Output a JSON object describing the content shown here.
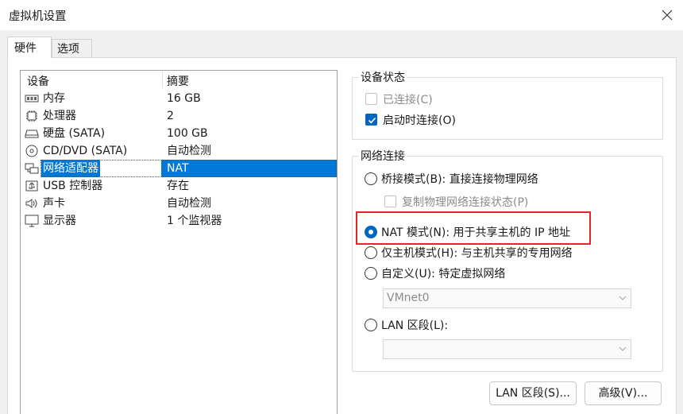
{
  "window": {
    "title": "虚拟机设置"
  },
  "tabs": [
    {
      "label": "硬件"
    },
    {
      "label": "选项"
    }
  ],
  "device_list": {
    "columns": [
      "设备",
      "摘要"
    ],
    "rows": [
      {
        "name": "内存",
        "summary": "16 GB",
        "icon": "memory-icon"
      },
      {
        "name": "处理器",
        "summary": "2",
        "icon": "processor-icon"
      },
      {
        "name": "硬盘 (SATA)",
        "summary": "100 GB",
        "icon": "hard-disk-icon"
      },
      {
        "name": "CD/DVD (SATA)",
        "summary": "自动检测",
        "icon": "cd-dvd-icon"
      },
      {
        "name": "网络适配器",
        "summary": "NAT",
        "icon": "network-adapter-icon",
        "selected": true
      },
      {
        "name": "USB 控制器",
        "summary": "存在",
        "icon": "usb-icon"
      },
      {
        "name": "声卡",
        "summary": "自动检测",
        "icon": "speaker-icon"
      },
      {
        "name": "显示器",
        "summary": "1 个监视器",
        "icon": "monitor-icon"
      }
    ]
  },
  "device_status": {
    "title": "设备状态",
    "connected": {
      "label": "已连接(C)",
      "checked": false,
      "enabled": false
    },
    "connect_at_power_on": {
      "label": "启动时连接(O)",
      "checked": true,
      "enabled": true
    }
  },
  "network_connection": {
    "title": "网络连接",
    "bridged": {
      "label": "桥接模式(B): 直接连接物理网络",
      "checked": false
    },
    "replicate": {
      "label": "复制物理网络连接状态(P)",
      "checked": false,
      "enabled": false
    },
    "nat": {
      "label": "NAT 模式(N): 用于共享主机的 IP 地址",
      "checked": true
    },
    "host_only": {
      "label": "仅主机模式(H): 与主机共享的专用网络",
      "checked": false
    },
    "custom": {
      "label": "自定义(U): 特定虚拟网络",
      "checked": false
    },
    "custom_select": {
      "value": "VMnet0"
    },
    "lan_segment": {
      "label": "LAN 区段(L):",
      "checked": false
    },
    "lan_select": {
      "value": ""
    }
  },
  "buttons": {
    "lan_segments": "LAN 区段(S)...",
    "advanced": "高级(V)..."
  },
  "colors": {
    "selection": "#0078d7",
    "accent": "#0067c0",
    "highlight": "#e0282a"
  }
}
